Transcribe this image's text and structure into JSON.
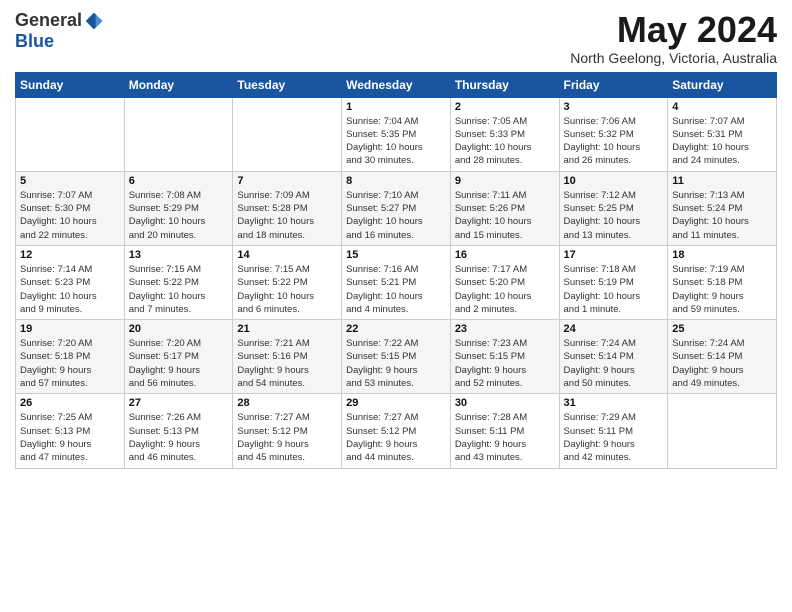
{
  "header": {
    "logo_general": "General",
    "logo_blue": "Blue",
    "month_title": "May 2024",
    "location": "North Geelong, Victoria, Australia"
  },
  "weekdays": [
    "Sunday",
    "Monday",
    "Tuesday",
    "Wednesday",
    "Thursday",
    "Friday",
    "Saturday"
  ],
  "weeks": [
    [
      {
        "day": "",
        "info": ""
      },
      {
        "day": "",
        "info": ""
      },
      {
        "day": "",
        "info": ""
      },
      {
        "day": "1",
        "info": "Sunrise: 7:04 AM\nSunset: 5:35 PM\nDaylight: 10 hours\nand 30 minutes."
      },
      {
        "day": "2",
        "info": "Sunrise: 7:05 AM\nSunset: 5:33 PM\nDaylight: 10 hours\nand 28 minutes."
      },
      {
        "day": "3",
        "info": "Sunrise: 7:06 AM\nSunset: 5:32 PM\nDaylight: 10 hours\nand 26 minutes."
      },
      {
        "day": "4",
        "info": "Sunrise: 7:07 AM\nSunset: 5:31 PM\nDaylight: 10 hours\nand 24 minutes."
      }
    ],
    [
      {
        "day": "5",
        "info": "Sunrise: 7:07 AM\nSunset: 5:30 PM\nDaylight: 10 hours\nand 22 minutes."
      },
      {
        "day": "6",
        "info": "Sunrise: 7:08 AM\nSunset: 5:29 PM\nDaylight: 10 hours\nand 20 minutes."
      },
      {
        "day": "7",
        "info": "Sunrise: 7:09 AM\nSunset: 5:28 PM\nDaylight: 10 hours\nand 18 minutes."
      },
      {
        "day": "8",
        "info": "Sunrise: 7:10 AM\nSunset: 5:27 PM\nDaylight: 10 hours\nand 16 minutes."
      },
      {
        "day": "9",
        "info": "Sunrise: 7:11 AM\nSunset: 5:26 PM\nDaylight: 10 hours\nand 15 minutes."
      },
      {
        "day": "10",
        "info": "Sunrise: 7:12 AM\nSunset: 5:25 PM\nDaylight: 10 hours\nand 13 minutes."
      },
      {
        "day": "11",
        "info": "Sunrise: 7:13 AM\nSunset: 5:24 PM\nDaylight: 10 hours\nand 11 minutes."
      }
    ],
    [
      {
        "day": "12",
        "info": "Sunrise: 7:14 AM\nSunset: 5:23 PM\nDaylight: 10 hours\nand 9 minutes."
      },
      {
        "day": "13",
        "info": "Sunrise: 7:15 AM\nSunset: 5:22 PM\nDaylight: 10 hours\nand 7 minutes."
      },
      {
        "day": "14",
        "info": "Sunrise: 7:15 AM\nSunset: 5:22 PM\nDaylight: 10 hours\nand 6 minutes."
      },
      {
        "day": "15",
        "info": "Sunrise: 7:16 AM\nSunset: 5:21 PM\nDaylight: 10 hours\nand 4 minutes."
      },
      {
        "day": "16",
        "info": "Sunrise: 7:17 AM\nSunset: 5:20 PM\nDaylight: 10 hours\nand 2 minutes."
      },
      {
        "day": "17",
        "info": "Sunrise: 7:18 AM\nSunset: 5:19 PM\nDaylight: 10 hours\nand 1 minute."
      },
      {
        "day": "18",
        "info": "Sunrise: 7:19 AM\nSunset: 5:18 PM\nDaylight: 9 hours\nand 59 minutes."
      }
    ],
    [
      {
        "day": "19",
        "info": "Sunrise: 7:20 AM\nSunset: 5:18 PM\nDaylight: 9 hours\nand 57 minutes."
      },
      {
        "day": "20",
        "info": "Sunrise: 7:20 AM\nSunset: 5:17 PM\nDaylight: 9 hours\nand 56 minutes."
      },
      {
        "day": "21",
        "info": "Sunrise: 7:21 AM\nSunset: 5:16 PM\nDaylight: 9 hours\nand 54 minutes."
      },
      {
        "day": "22",
        "info": "Sunrise: 7:22 AM\nSunset: 5:15 PM\nDaylight: 9 hours\nand 53 minutes."
      },
      {
        "day": "23",
        "info": "Sunrise: 7:23 AM\nSunset: 5:15 PM\nDaylight: 9 hours\nand 52 minutes."
      },
      {
        "day": "24",
        "info": "Sunrise: 7:24 AM\nSunset: 5:14 PM\nDaylight: 9 hours\nand 50 minutes."
      },
      {
        "day": "25",
        "info": "Sunrise: 7:24 AM\nSunset: 5:14 PM\nDaylight: 9 hours\nand 49 minutes."
      }
    ],
    [
      {
        "day": "26",
        "info": "Sunrise: 7:25 AM\nSunset: 5:13 PM\nDaylight: 9 hours\nand 47 minutes."
      },
      {
        "day": "27",
        "info": "Sunrise: 7:26 AM\nSunset: 5:13 PM\nDaylight: 9 hours\nand 46 minutes."
      },
      {
        "day": "28",
        "info": "Sunrise: 7:27 AM\nSunset: 5:12 PM\nDaylight: 9 hours\nand 45 minutes."
      },
      {
        "day": "29",
        "info": "Sunrise: 7:27 AM\nSunset: 5:12 PM\nDaylight: 9 hours\nand 44 minutes."
      },
      {
        "day": "30",
        "info": "Sunrise: 7:28 AM\nSunset: 5:11 PM\nDaylight: 9 hours\nand 43 minutes."
      },
      {
        "day": "31",
        "info": "Sunrise: 7:29 AM\nSunset: 5:11 PM\nDaylight: 9 hours\nand 42 minutes."
      },
      {
        "day": "",
        "info": ""
      }
    ]
  ]
}
